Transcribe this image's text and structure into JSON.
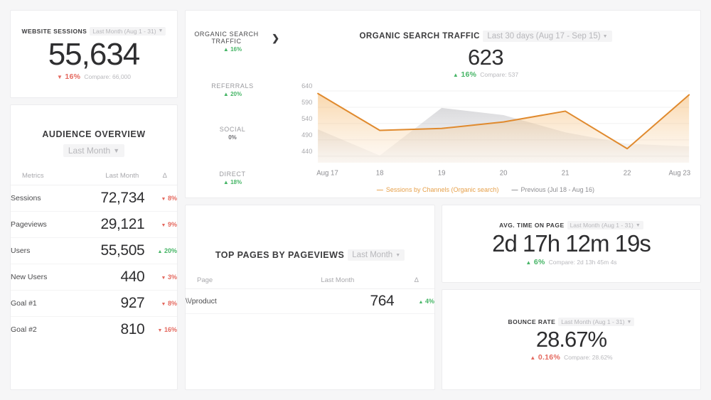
{
  "cards": {
    "website_sessions": {
      "title": "WEBSITE SESSIONS",
      "range": "Last Month (Aug 1 - 31)",
      "value": "55,634",
      "delta": "16%",
      "delta_dir": "down",
      "delta_arrow": "▼",
      "compare": "Compare: 66,000"
    },
    "audience_overview": {
      "title": "AUDIENCE OVERVIEW",
      "range": "Last Month",
      "columns": [
        "Metrics",
        "Last Month",
        "Δ"
      ],
      "rows": [
        {
          "metric": "Sessions",
          "value": "72,734",
          "delta": "8%",
          "dir": "down",
          "arrow": "▼"
        },
        {
          "metric": "Pageviews",
          "value": "29,121",
          "delta": "9%",
          "dir": "down",
          "arrow": "▼"
        },
        {
          "metric": "Users",
          "value": "55,505",
          "delta": "20%",
          "dir": "up",
          "arrow": "▲"
        },
        {
          "metric": "New Users",
          "value": "440",
          "delta": "3%",
          "dir": "down",
          "arrow": "▼"
        },
        {
          "metric": "Goal #1",
          "value": "927",
          "delta": "8%",
          "dir": "down",
          "arrow": "▼"
        },
        {
          "metric": "Goal #2",
          "value": "810",
          "delta": "16%",
          "dir": "down",
          "arrow": "▼"
        }
      ]
    },
    "organic_panel": {
      "channels": [
        {
          "name": "ORGANIC SEARCH TRAFFIC",
          "delta": "16%",
          "dir": "up",
          "arrow": "▲",
          "selected": true
        },
        {
          "name": "REFERRALS",
          "delta": "20%",
          "dir": "up",
          "arrow": "▲",
          "selected": false
        },
        {
          "name": "SOCIAL",
          "delta": "0%",
          "dir": "flat",
          "arrow": "",
          "selected": false
        },
        {
          "name": "DIRECT",
          "delta": "18%",
          "dir": "up",
          "arrow": "▲",
          "selected": false
        }
      ],
      "chevron": "❯",
      "title": "ORGANIC SEARCH TRAFFIC",
      "range": "Last 30 days (Aug 17 - Sep 15)",
      "value": "623",
      "delta": "16%",
      "delta_dir": "up",
      "delta_arrow": "▲",
      "compare": "Compare: 537",
      "legend": [
        {
          "label": "Sessions by Channels (Organic search)",
          "color": "#e6a04a"
        },
        {
          "label": "Previous (Jul 18 - Aug 16)",
          "color": "#8e8e92"
        }
      ]
    },
    "top_pages": {
      "title": "TOP PAGES BY PAGEVIEWS",
      "range": "Last Month",
      "columns": [
        "Page",
        "Last Month",
        "Δ"
      ],
      "rows": [
        {
          "page": "\\\\/product",
          "value": "764",
          "delta": "4%",
          "dir": "up",
          "arrow": "▲"
        }
      ]
    },
    "avg_time_on_page": {
      "title": "AVG. TIME ON PAGE",
      "range": "Last Month (Aug 1 - 31)",
      "value": "2d 17h 12m 19s",
      "delta": "6%",
      "delta_dir": "up",
      "delta_arrow": "▲",
      "compare": "Compare: 2d 13h 45m 4s"
    },
    "bounce_rate": {
      "title": "BOUNCE RATE",
      "range": "Last Month (Aug 1 - 31)",
      "value": "28.67%",
      "delta": "0.16%",
      "delta_dir": "down",
      "delta_arrow": "▲",
      "compare": "Compare: 28.62%"
    }
  },
  "chart_data": {
    "type": "area",
    "title": "ORGANIC SEARCH TRAFFIC",
    "xlabel": "",
    "ylabel": "",
    "x": [
      "Aug 17",
      "18",
      "19",
      "20",
      "21",
      "22",
      "Aug 23"
    ],
    "yticks": [
      440,
      490,
      540,
      590,
      640
    ],
    "ylim": [
      420,
      660
    ],
    "grid": true,
    "legend_position": "bottom",
    "series": [
      {
        "name": "Sessions by Channels (Organic search)",
        "color": "#e08a2e",
        "values": [
          632,
          519,
          525,
          545,
          578,
          463,
          628
        ]
      },
      {
        "name": "Previous (Jul 18 - Aug 16)",
        "color": "#b9b9bd",
        "values": [
          522,
          442,
          588,
          566,
          513,
          478,
          470
        ]
      }
    ]
  }
}
